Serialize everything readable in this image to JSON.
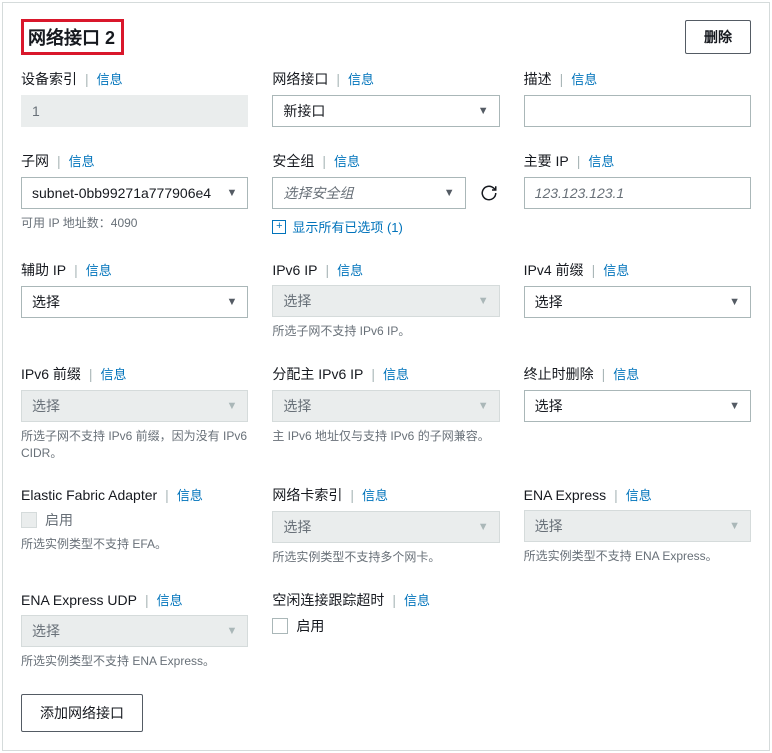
{
  "header": {
    "title": "网络接口 2",
    "delete_label": "删除"
  },
  "info_label": "信息",
  "fields": {
    "device_index": {
      "label": "设备索引",
      "value": "1"
    },
    "network_interface": {
      "label": "网络接口",
      "value": "新接口"
    },
    "description": {
      "label": "描述"
    },
    "subnet": {
      "label": "子网",
      "value": "subnet-0bb99271a777906e4",
      "helper": "可用 IP 地址数：4090"
    },
    "security_group": {
      "label": "安全组",
      "placeholder": "选择安全组",
      "show_all": "显示所有已选项 (1)"
    },
    "primary_ip": {
      "label": "主要 IP",
      "placeholder": "123.123.123.1"
    },
    "secondary_ip": {
      "label": "辅助 IP",
      "value": "选择"
    },
    "ipv6_ip": {
      "label": "IPv6 IP",
      "value": "选择",
      "helper": "所选子网不支持 IPv6 IP。"
    },
    "ipv4_prefix": {
      "label": "IPv4 前缀",
      "value": "选择"
    },
    "ipv6_prefix": {
      "label": "IPv6 前缀",
      "value": "选择",
      "helper": "所选子网不支持 IPv6 前缀，因为没有 IPv6 CIDR。"
    },
    "assign_primary_ipv6": {
      "label": "分配主 IPv6 IP",
      "value": "选择",
      "helper": "主 IPv6 地址仅与支持 IPv6 的子网兼容。"
    },
    "delete_on_termination": {
      "label": "终止时删除",
      "value": "选择"
    },
    "efa": {
      "label": "Elastic Fabric Adapter",
      "checkbox": "启用",
      "helper": "所选实例类型不支持 EFA。"
    },
    "nic_index": {
      "label": "网络卡索引",
      "value": "选择",
      "helper": "所选实例类型不支持多个网卡。"
    },
    "ena_express": {
      "label": "ENA Express",
      "value": "选择",
      "helper": "所选实例类型不支持 ENA Express。"
    },
    "ena_express_udp": {
      "label": "ENA Express UDP",
      "value": "选择",
      "helper": "所选实例类型不支持 ENA Express。"
    },
    "idle_timeout": {
      "label": "空闲连接跟踪超时",
      "checkbox": "启用"
    }
  },
  "footer": {
    "add_label": "添加网络接口"
  }
}
